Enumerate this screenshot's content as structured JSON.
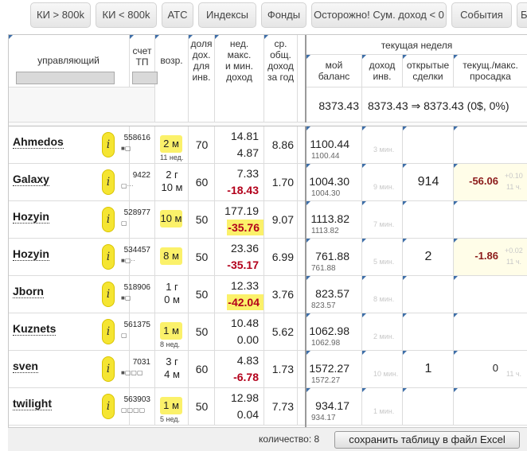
{
  "tabs": [
    "КИ > 800k",
    "КИ < 800k",
    "АТС",
    "Индексы",
    "Фонды",
    "Осторожно! Сум. доход < 0",
    "События",
    "Б"
  ],
  "headers": {
    "manager": "управляющий",
    "account": [
      "счет",
      "ТП"
    ],
    "age": "возр.",
    "share": [
      "доля",
      "дох.",
      "для",
      "инв."
    ],
    "maxmin": [
      "нед.",
      "макс.",
      "и мин.",
      "доход"
    ],
    "avg": [
      "ср.",
      "общ.",
      "доход",
      "за год"
    ],
    "week": "текущая неделя",
    "balance": [
      "мой",
      "баланс"
    ],
    "income": [
      "доход",
      "инв."
    ],
    "deals": [
      "открытые",
      "сделки"
    ],
    "drawdown": [
      "текущ./макс.",
      "просадка"
    ]
  },
  "summary": {
    "balance": "8373.43",
    "change": "8373.43 ⇒ 8373.43 (0$, 0%)"
  },
  "rows": [
    {
      "name": "Ahmedos",
      "account": "558616",
      "dots": "■▢",
      "age_main": "2 м",
      "age_sub": "11 нед.",
      "age_badge": true,
      "share": "70",
      "max": "14.81",
      "min": "4.87",
      "min_neg": false,
      "avg": "8.86",
      "balance": "1100.44",
      "balance_sub": "1100.44",
      "income": "3 мин.",
      "deals": "",
      "drawdown": "",
      "drawdown_sub": "",
      "drawdown_sub2": ""
    },
    {
      "name": "Galaxy",
      "account": "9422",
      "dots": "▢···",
      "age_main": "2 г",
      "age_sub": "10 м",
      "age_badge": false,
      "share": "60",
      "max": "7.33",
      "min": "-18.43",
      "min_neg": true,
      "avg": "1.70",
      "balance": "1004.30",
      "balance_sub": "1004.30",
      "income": "9 мин.",
      "deals": "914",
      "drawdown": "-56.06",
      "drawdown_sub": "+0.10",
      "drawdown_sub2": "11 ч."
    },
    {
      "name": "Hozyin",
      "account": "528977",
      "dots": "▢",
      "age_main": "10 м",
      "age_sub": "",
      "age_badge": true,
      "share": "50",
      "max": "177.19",
      "min": "-35.76",
      "min_neg": true,
      "avg": "9.07",
      "balance": "1113.82",
      "balance_sub": "1113.82",
      "income": "7 мин.",
      "deals": "",
      "drawdown": "",
      "drawdown_sub": "",
      "drawdown_sub2": ""
    },
    {
      "name": "Hozyin",
      "account": "534457",
      "dots": "■▢··",
      "age_main": "8 м",
      "age_sub": "",
      "age_badge": true,
      "share": "50",
      "max": "23.36",
      "min": "-35.17",
      "min_neg": true,
      "avg": "6.99",
      "balance": "761.88",
      "balance_sub": "761.88",
      "income": "5 мин.",
      "deals": "2",
      "drawdown": "-1.86",
      "drawdown_sub": "+0.02",
      "drawdown_sub2": "11 ч."
    },
    {
      "name": "Jborn",
      "account": "518906",
      "dots": "■▢",
      "age_main": "1 г",
      "age_sub": "0 м",
      "age_badge": false,
      "share": "50",
      "max": "12.33",
      "min": "-42.04",
      "min_neg": true,
      "avg": "3.76",
      "balance": "823.57",
      "balance_sub": "823.57",
      "income": "8 мин.",
      "deals": "",
      "drawdown": "",
      "drawdown_sub": "",
      "drawdown_sub2": ""
    },
    {
      "name": "Kuznets",
      "account": "561375",
      "dots": "▢",
      "age_main": "1 м",
      "age_sub": "8 нед.",
      "age_badge": true,
      "share": "50",
      "max": "10.48",
      "min": "0.00",
      "min_neg": false,
      "avg": "5.62",
      "balance": "1062.98",
      "balance_sub": "1062.98",
      "income": "2 мин.",
      "deals": "",
      "drawdown": "",
      "drawdown_sub": "",
      "drawdown_sub2": ""
    },
    {
      "name": "sven",
      "account": "7031",
      "dots": "■▢▢▢",
      "age_main": "3 г",
      "age_sub": "4 м",
      "age_badge": false,
      "share": "60",
      "max": "4.83",
      "min": "-6.78",
      "min_neg": true,
      "avg": "1.73",
      "balance": "1572.27",
      "balance_sub": "1572.27",
      "income": "10 мин.",
      "deals": "1",
      "drawdown": "0",
      "drawdown_sub": "",
      "drawdown_sub2": "11 ч."
    },
    {
      "name": "twilight",
      "account": "563903",
      "dots": "▢▢▢▢",
      "age_main": "1 м",
      "age_sub": "5 нед.",
      "age_badge": true,
      "share": "50",
      "max": "12.98",
      "min": "0.04",
      "min_neg": false,
      "avg": "7.73",
      "balance": "934.17",
      "balance_sub": "934.17",
      "income": "1 мин.",
      "deals": "",
      "drawdown": "",
      "drawdown_sub": "",
      "drawdown_sub2": ""
    }
  ],
  "footer": {
    "count_label": "количество: 8",
    "save_label": "сохранить таблицу в файл Excel"
  },
  "info_glyph": "i"
}
